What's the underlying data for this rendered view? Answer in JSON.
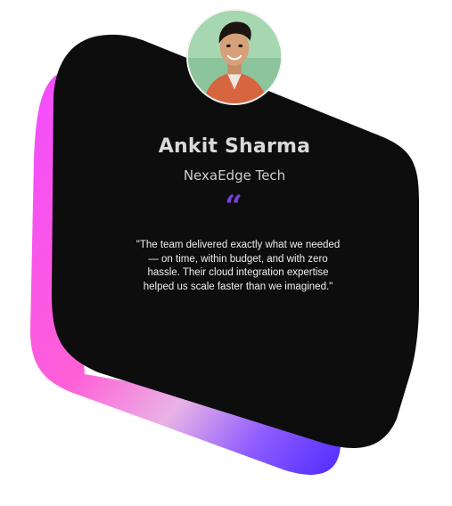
{
  "testimonial": {
    "name": "Ankit Sharma",
    "company": "NexaEdge Tech",
    "quote_icon": "quote-icon",
    "quote": "\"The team delivered exactly what we needed — on time, within budget, and with zero hassle. Their cloud integration expertise helped us scale faster than we imagined.\"",
    "avatar_icon": "user-avatar"
  },
  "colors": {
    "card": "#0d0d0d",
    "accent_quote": "#7a3fe0",
    "gradient_pink": "#f04bff",
    "gradient_blue": "#5a2cff"
  }
}
